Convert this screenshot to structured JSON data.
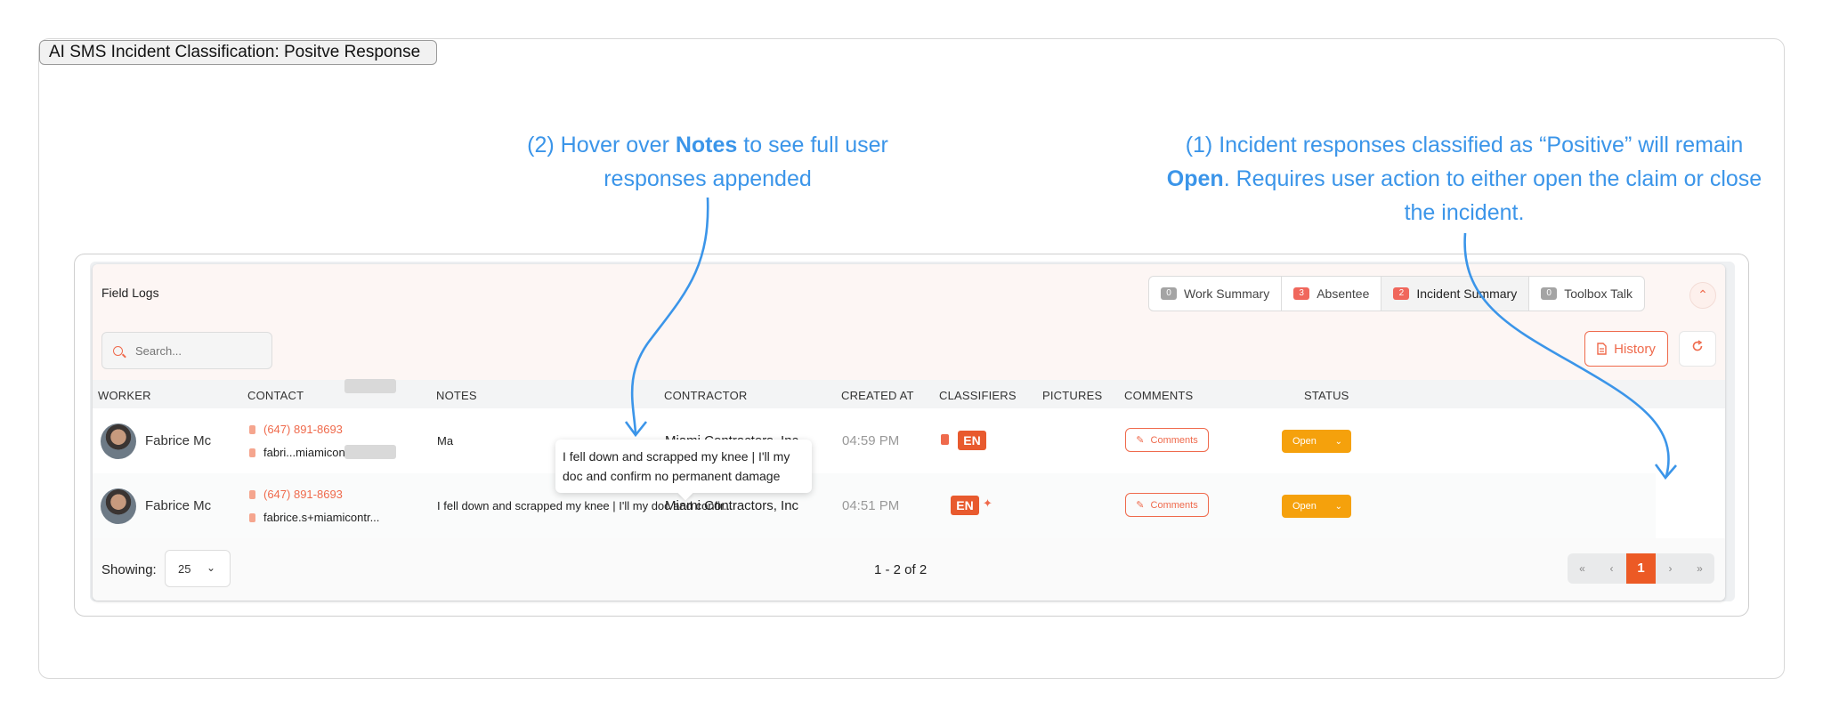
{
  "frame_tag": "AI SMS Incident Classification: Positve Response",
  "annotations": {
    "note2": {
      "pre": "(2) Hover over ",
      "bold": "Notes",
      "post": " to see full user responses appended"
    },
    "note1": {
      "pre": "(1) Incident responses classified as “Positive” will remain ",
      "bold": "Open",
      "post": ". Requires user action to either open the claim or close the incident."
    }
  },
  "panel": {
    "title": "Field Logs",
    "tabs": [
      {
        "count": "0",
        "label": "Work Summary",
        "badge_color": "#a4a4a4"
      },
      {
        "count": "3",
        "label": "Absentee",
        "badge_color": "#f0675c"
      },
      {
        "count": "2",
        "label": "Incident Summary",
        "badge_color": "#f0675c",
        "active": true
      },
      {
        "count": "0",
        "label": "Toolbox Talk",
        "badge_color": "#a4a4a4"
      }
    ],
    "collapse_icon": "chevron-up-icon",
    "search_placeholder": "Search...",
    "history_label": "History",
    "columns": [
      "WORKER",
      "CONTACT",
      "NOTES",
      "CONTRACTOR",
      "CREATED AT",
      "CLASSIFIERS",
      "PICTURES",
      "COMMENTS",
      "STATUS"
    ],
    "rows": [
      {
        "worker": "Fabrice Mc",
        "phone": "(647) 891-8693",
        "email": "fabri...miamicontr...",
        "note": "Ma",
        "contractor": "Miami Contractors, Inc",
        "created_at": "04:59 PM",
        "classifier": "EN",
        "comments_label": "Comments",
        "status": "Open"
      },
      {
        "worker": "Fabrice Mc",
        "phone": "(647) 891-8693",
        "email": "fabrice.s+miamicontr...",
        "note": "I fell down and scrapped my knee | I'll my doc and confir...",
        "contractor": "Miami Contractors, Inc",
        "created_at": "04:51 PM",
        "classifier": "EN",
        "comments_label": "Comments",
        "status": "Open"
      }
    ],
    "tooltip": "I fell down and scrapped my knee | I'll my doc and confirm no permanent damage",
    "footer": {
      "showing_label": "Showing:",
      "page_size": "25",
      "range": "1 - 2 of 2",
      "pager": [
        "«",
        "‹",
        "1",
        "›",
        "»"
      ],
      "current_page": "1"
    }
  },
  "colors": {
    "accent": "#ef6a4c",
    "annotation": "#3b95e9",
    "status_open": "#f5a10c",
    "page_active": "#ec5a25"
  }
}
